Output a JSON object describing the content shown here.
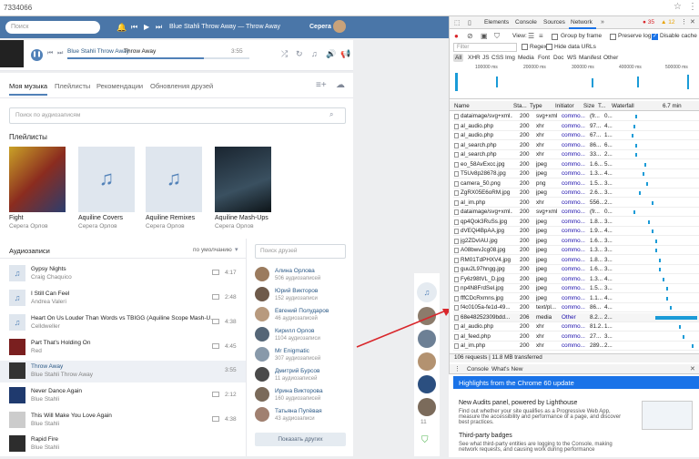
{
  "browser": {
    "url_fragment": "7334066"
  },
  "vk": {
    "search_placeholder": "Поиск",
    "header_track": "Blue Stahli Throw Away — Throw Away",
    "user_name": "Серега",
    "player": {
      "artist": "Blue Stahli Throw Away",
      "title": "Throw Away",
      "time": "3:55",
      "progress": 0.75
    },
    "tabs": [
      "Моя музыка",
      "Плейлисты",
      "Рекомендации",
      "Обновления друзей"
    ],
    "audio_search_placeholder": "Поиск по аудиозаписям",
    "playlists_heading": "Плейлисты",
    "playlists": [
      {
        "title": "Fight",
        "sub": "Серега Орлов"
      },
      {
        "title": "Aquiline Covers",
        "sub": "Серега Орлов"
      },
      {
        "title": "Aquiline Remixes",
        "sub": "Серега Орлов"
      },
      {
        "title": "Aquiline Mash-Ups",
        "sub": "Серега Орлов"
      }
    ],
    "audio_heading": "Аудиозаписи",
    "sort_label": "по умолчанию",
    "tracks": [
      {
        "name": "Gypsy Nights",
        "artist": "Craig Chaquico",
        "dur": "4:17"
      },
      {
        "name": "I Still Can Feel",
        "artist": "Andrea Valeri",
        "dur": "2:48"
      },
      {
        "name": "Heart On Us Louder Than Words vs TBIGG (Aquiline Scope Mash-U...",
        "artist": "Celldweller",
        "dur": "4:38"
      },
      {
        "name": "Part That's Holding On",
        "artist": "Red",
        "dur": "4:45"
      },
      {
        "name": "Throw Away",
        "artist": "Blue Stahli Throw Away",
        "dur": "3:55"
      },
      {
        "name": "Never Dance Again",
        "artist": "Blue Stahli",
        "dur": "2:12"
      },
      {
        "name": "This Will Make You Love Again",
        "artist": "Blue Stahli",
        "dur": "4:38"
      },
      {
        "name": "Rapid Fire",
        "artist": "Blue Stahli",
        "dur": ""
      }
    ],
    "friends_search_placeholder": "Поиск друзей",
    "friends": [
      {
        "name": "Алина Орлова",
        "count": "506 аудиозаписей"
      },
      {
        "name": "Юрий Викторов",
        "count": "152 аудиозаписи"
      },
      {
        "name": "Евгений Полударов",
        "count": "46 аудиозаписей"
      },
      {
        "name": "Кирилл Орлов",
        "count": "1104 аудиозаписи"
      },
      {
        "name": "Mr Enigmatic",
        "count": "307 аудиозаписей"
      },
      {
        "name": "Дмитрий Бурсов",
        "count": "11 аудиозаписей"
      },
      {
        "name": "Ирина Викторова",
        "count": "160 аудиозаписей"
      },
      {
        "name": "Татьяна Пупёвая",
        "count": "43 аудиозаписи"
      }
    ],
    "show_friends_button": "Показать других",
    "side_count": "11"
  },
  "devtools": {
    "tabs": [
      "Elements",
      "Console",
      "Sources",
      "Network"
    ],
    "errors": "35",
    "warnings": "12",
    "toolbar": {
      "view": "View:",
      "group_by_frame": "Group by frame",
      "preserve_log": "Preserve log",
      "disable_cache": "Disable cache"
    },
    "filter_placeholder": "Filter",
    "regex": "Regex",
    "hide_data_urls": "Hide data URLs",
    "types": [
      "All",
      "XHR",
      "JS",
      "CSS",
      "Img",
      "Media",
      "Font",
      "Doc",
      "WS",
      "Manifest",
      "Other"
    ],
    "timeline_labels": [
      "100000 ms",
      "200000 ms",
      "300000 ms",
      "400000 ms",
      "500000 ms"
    ],
    "columns": [
      "Name",
      "Sta...",
      "Type",
      "Initiator",
      "Size",
      "T...",
      "Waterfall"
    ],
    "waterfall_label": "6.7 min",
    "rows": [
      {
        "name": "dataimage/svg+xml...",
        "status": "200",
        "type": "svg+xml",
        "init": "commo...",
        "size": "(fr...",
        "t": "0..."
      },
      {
        "name": "al_audio.php",
        "status": "200",
        "type": "xhr",
        "init": "commo...",
        "size": "97...",
        "t": "4..."
      },
      {
        "name": "al_audio.php",
        "status": "200",
        "type": "xhr",
        "init": "commo...",
        "size": "67...",
        "t": "1..."
      },
      {
        "name": "al_search.php",
        "status": "200",
        "type": "xhr",
        "init": "commo...",
        "size": "86...",
        "t": "6..."
      },
      {
        "name": "al_search.php",
        "status": "200",
        "type": "xhr",
        "init": "commo...",
        "size": "33...",
        "t": "2..."
      },
      {
        "name": "eo_58AvExcc.jpg",
        "status": "200",
        "type": "jpeg",
        "init": "commo...",
        "size": "1.6...",
        "t": "5..."
      },
      {
        "name": "T5Uv8p28678.jpg",
        "status": "200",
        "type": "jpeg",
        "init": "commo...",
        "size": "1.3...",
        "t": "4..."
      },
      {
        "name": "camera_50.png",
        "status": "200",
        "type": "png",
        "init": "commo...",
        "size": "1.5...",
        "t": "3..."
      },
      {
        "name": "ZgRX05E6oRM.jpg",
        "status": "200",
        "type": "jpeg",
        "init": "commo...",
        "size": "2.6...",
        "t": "3..."
      },
      {
        "name": "al_im.php",
        "status": "200",
        "type": "xhr",
        "init": "commo...",
        "size": "556...",
        "t": "2..."
      },
      {
        "name": "dataimage/svg+xml...",
        "status": "200",
        "type": "svg+xml",
        "init": "commo...",
        "size": "(fr...",
        "t": "0..."
      },
      {
        "name": "qp4Qok3RuSs.jpg",
        "status": "200",
        "type": "jpeg",
        "init": "commo...",
        "size": "1.8...",
        "t": "3..."
      },
      {
        "name": "dVEQi4BpAA.jpg",
        "status": "200",
        "type": "jpeg",
        "init": "commo...",
        "size": "1.9...",
        "t": "4..."
      },
      {
        "name": "jg2ZDvIAU.jpg",
        "status": "200",
        "type": "jpeg",
        "init": "commo...",
        "size": "1.6...",
        "t": "3..."
      },
      {
        "name": "A08bwvJcg08.jpg",
        "status": "200",
        "type": "jpeg",
        "init": "commo...",
        "size": "1.3...",
        "t": "3..."
      },
      {
        "name": "RM01TdPHXV4.jpg",
        "status": "200",
        "type": "jpeg",
        "init": "commo...",
        "size": "1.8...",
        "t": "3..."
      },
      {
        "name": "guu2L97hngg.jpg",
        "status": "200",
        "type": "jpeg",
        "init": "commo...",
        "size": "1.6...",
        "t": "3..."
      },
      {
        "name": "Fy6z98tVL_D.jpg",
        "status": "200",
        "type": "jpeg",
        "init": "commo...",
        "size": "1.3...",
        "t": "4..."
      },
      {
        "name": "np4N8FrdSel.jpg",
        "status": "200",
        "type": "jpeg",
        "init": "commo...",
        "size": "1.5...",
        "t": "3..."
      },
      {
        "name": "fffCDcRxmns.jpg",
        "status": "200",
        "type": "jpeg",
        "init": "commo...",
        "size": "1.1...",
        "t": "4..."
      },
      {
        "name": "f4c0105a-fe1d-49...",
        "status": "200",
        "type": "text/pl...",
        "init": "commo...",
        "size": "86...",
        "t": "4..."
      },
      {
        "name": "68e48252309bdd...",
        "status": "206",
        "type": "media",
        "init": "Other",
        "size": "8.2...",
        "t": "2..."
      },
      {
        "name": "al_audio.php",
        "status": "200",
        "type": "xhr",
        "init": "commo...",
        "size": "81.2...",
        "t": "1..."
      },
      {
        "name": "al_feed.php",
        "status": "200",
        "type": "xhr",
        "init": "commo...",
        "size": "27...",
        "t": "3..."
      },
      {
        "name": "al_im.php",
        "status": "200",
        "type": "xhr",
        "init": "commo...",
        "size": "289...",
        "t": "2..."
      }
    ],
    "summary": "106 requests | 11.8 MB transferred",
    "drawer_tabs": [
      "Console",
      "What's New"
    ],
    "whats_new_banner": "Highlights from the Chrome 60 update",
    "items": [
      {
        "h": "New Audits panel, powered by Lighthouse",
        "p": "Find out whether your site qualifies as a Progressive Web App, measure the accessibility and performance of a page, and discover best practices."
      },
      {
        "h": "Third-party badges",
        "p": "See what third-party entities are logging to the Console, making network requests, and causing work during performance"
      }
    ]
  }
}
